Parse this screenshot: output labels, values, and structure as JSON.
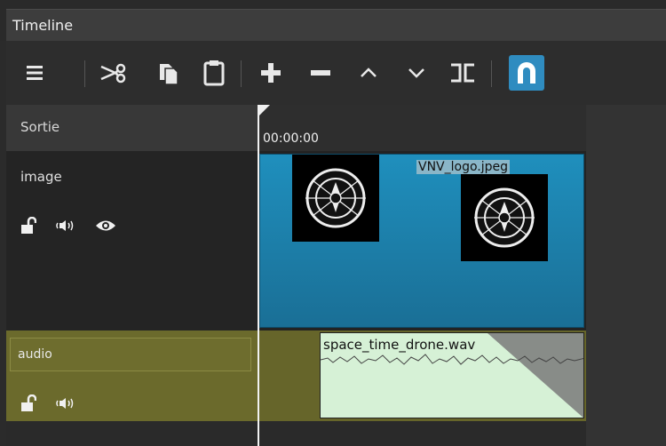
{
  "panel": {
    "title": "Timeline"
  },
  "toolbar": {
    "buttons": [
      {
        "name": "menu-button",
        "icon": "hamburger-menu-icon",
        "tooltip": "Timeline Menu"
      },
      {
        "name": "cut-button",
        "icon": "scissors-icon",
        "tooltip": "Cut"
      },
      {
        "name": "copy-button",
        "icon": "copy-icon",
        "tooltip": "Copy"
      },
      {
        "name": "paste-button",
        "icon": "clipboard-icon",
        "tooltip": "Paste"
      },
      {
        "name": "append-button",
        "icon": "plus-icon",
        "tooltip": "Append"
      },
      {
        "name": "ripple-delete-button",
        "icon": "minus-icon",
        "tooltip": "Ripple Delete"
      },
      {
        "name": "lift-button",
        "icon": "chevron-up-icon",
        "tooltip": "Lift"
      },
      {
        "name": "overwrite-button",
        "icon": "chevron-down-icon",
        "tooltip": "Overwrite"
      },
      {
        "name": "split-button",
        "icon": "split-icon",
        "tooltip": "Split At Playhead"
      },
      {
        "name": "snap-button",
        "icon": "magnet-icon",
        "tooltip": "Snap"
      }
    ]
  },
  "tracks": {
    "output": {
      "label": "Sortie"
    },
    "image": {
      "label": "image"
    },
    "audio": {
      "label": "audio"
    }
  },
  "ruler": {
    "timecode": "00:00:00"
  },
  "clips": {
    "image": {
      "name": "VNV_logo.jpeg"
    },
    "audio": {
      "name": "space_time_drone.wav"
    }
  },
  "colors": {
    "accent": "#1e8ec0",
    "audio_track": "#6b6a2c",
    "audio_clip": "#d6f1d6",
    "snap_active": "#3aa0d0"
  }
}
